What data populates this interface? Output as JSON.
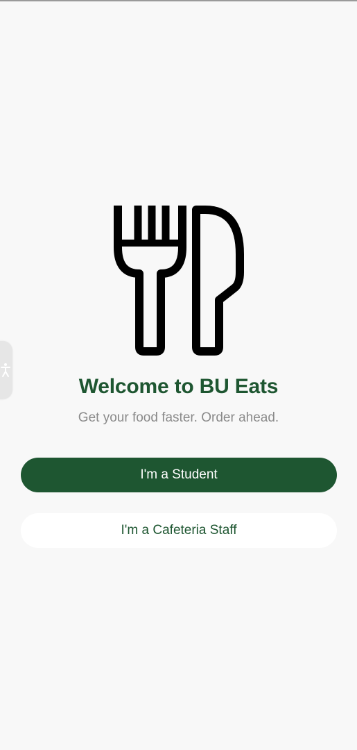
{
  "welcome": {
    "title": "Welcome to BU Eats",
    "subtitle": "Get your food faster. Order ahead."
  },
  "actions": {
    "student_label": "I'm a Student",
    "staff_label": "I'm a Cafeteria Staff"
  },
  "icons": {
    "logo": "fork-knife-icon",
    "accessibility": "accessibility-icon"
  },
  "colors": {
    "primary": "#1e5631",
    "background": "#f8f8f8",
    "subtitle": "#8a8a8a",
    "secondary_button": "#ffffff"
  }
}
